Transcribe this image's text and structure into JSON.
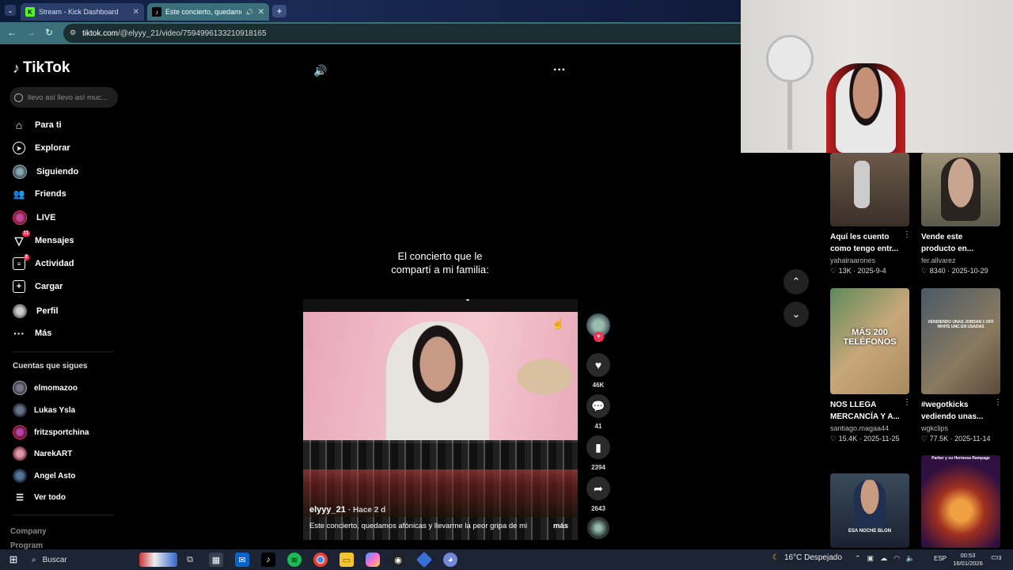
{
  "browser": {
    "tabs": [
      {
        "title": "Stream - Kick Dashboard",
        "active": false
      },
      {
        "title": "Este concierto, quedamos",
        "active": true
      }
    ],
    "url_host": "tiktok.com",
    "url_path": "/@elyyy_21/video/7594996133210918165"
  },
  "sidebar": {
    "logo": "TikTok",
    "search_placeholder": "llevo así llevo así muc...",
    "nav": [
      {
        "label": "Para ti",
        "icon": "home-icon"
      },
      {
        "label": "Explorar",
        "icon": "compass-icon"
      },
      {
        "label": "Siguiendo",
        "icon": "following-avatar-icon"
      },
      {
        "label": "Friends",
        "icon": "friends-icon"
      },
      {
        "label": "LIVE",
        "icon": "live-icon"
      },
      {
        "label": "Mensajes",
        "icon": "message-icon",
        "badge": "11"
      },
      {
        "label": "Actividad",
        "icon": "activity-icon",
        "badge": "2"
      },
      {
        "label": "Cargar",
        "icon": "upload-icon"
      },
      {
        "label": "Perfil",
        "icon": "profile-icon"
      },
      {
        "label": "Más",
        "icon": "more-icon"
      }
    ],
    "following_header": "Cuentas que sigues",
    "following": [
      {
        "name": "elmomazoo"
      },
      {
        "name": "Lukas Ysla"
      },
      {
        "name": "fritzsportchina"
      },
      {
        "name": "NarekART"
      },
      {
        "name": "Angel Asto"
      }
    ],
    "see_all": "Ver todo",
    "footer": [
      "Company",
      "Program"
    ]
  },
  "video": {
    "caption_overlay_line1": "El concierto que le",
    "caption_overlay_line2": "compartí a mi familia:",
    "author": "elyyy_21",
    "time_ago": "· Hace 2 d",
    "description": "Este concierto, quedamos afónicas y llevarme la peor gripa de mi",
    "more_label": "más",
    "likes": "46K",
    "comments": "41",
    "saves": "2394",
    "shares": "2643"
  },
  "recommended": [
    {
      "title_line1": "Aquí les cuento",
      "title_line2": "como tengo entr...",
      "user": "yahairaarones",
      "likes": "13K",
      "date": "2025-9-4"
    },
    {
      "title_line1": "Vende este",
      "title_line2": "producto en...",
      "user": "fer.allvarez",
      "likes": "8340",
      "date": "2025-10-29"
    },
    {
      "title_line1": "NOS LLEGA",
      "title_line2": "MERCANCÍA Y A...",
      "user": "santiago.magaa44",
      "likes": "15.4K",
      "date": "2025-11-25",
      "thumb_text": "MÁS 200 TELÉFONOS"
    },
    {
      "title_line1": "#wegotkicks",
      "title_line2": "vediendo unas...",
      "user": "wgkclips",
      "likes": "77.5K",
      "date": "2025-11-14",
      "thumb_text": "VENDIENDO UNAS JORDAN 1 OFF WHITE UNC EN USADAS"
    },
    {
      "thumb_text": "ESA NOCHE BLON"
    },
    {
      "thumb_text": "Parker y su Hermosa Rampage"
    }
  ],
  "taskbar": {
    "search_label": "Buscar",
    "weather": "16°C Despejado",
    "lang": "ESP",
    "time": "00:53",
    "date": "16/01/2026",
    "notif_count": "3"
  },
  "colors": {
    "accent": "#fe2c55",
    "bg": "#000000",
    "taskbar": "#1c2433"
  }
}
